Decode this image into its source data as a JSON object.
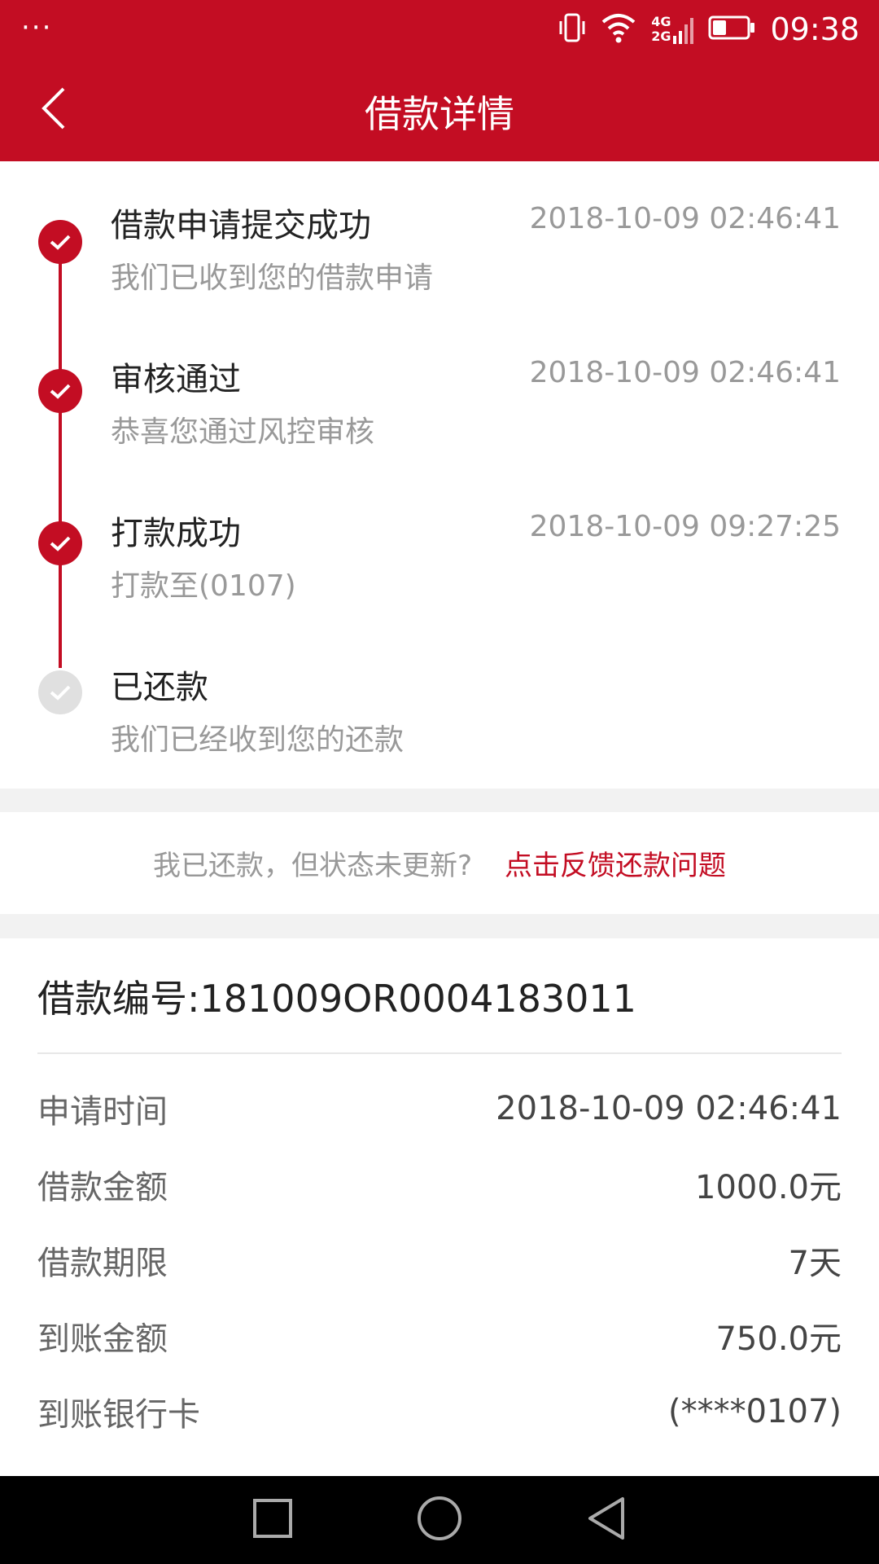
{
  "status_bar": {
    "menu_dots": "···",
    "network_top": "4G",
    "network_bottom": "2G",
    "time": "09:38"
  },
  "header": {
    "title": "借款详情"
  },
  "timeline": [
    {
      "title": "借款申请提交成功",
      "time": "2018-10-09 02:46:41",
      "desc": "我们已收到您的借款申请",
      "done": true
    },
    {
      "title": "审核通过",
      "time": "2018-10-09 02:46:41",
      "desc": "恭喜您通过风控审核",
      "done": true
    },
    {
      "title": "打款成功",
      "time": "2018-10-09 09:27:25",
      "desc": "打款至(0107)",
      "done": true
    },
    {
      "title": "已还款",
      "time": "",
      "desc": "我们已经收到您的还款",
      "done": false
    }
  ],
  "feedback": {
    "text": "我已还款，但状态未更新?",
    "link": "点击反馈还款问题"
  },
  "details": {
    "loan_number": "借款编号:181009OR0004183011",
    "rows": [
      {
        "label": "申请时间",
        "value": "2018-10-09 02:46:41"
      },
      {
        "label": "借款金额",
        "value": "1000.0元"
      },
      {
        "label": "借款期限",
        "value": "7天"
      },
      {
        "label": "到账金额",
        "value": "750.0元"
      },
      {
        "label": "到账银行卡",
        "value": "(****0107)"
      }
    ]
  },
  "colors": {
    "accent": "#c30d23",
    "pending": "#e0e0e0"
  }
}
